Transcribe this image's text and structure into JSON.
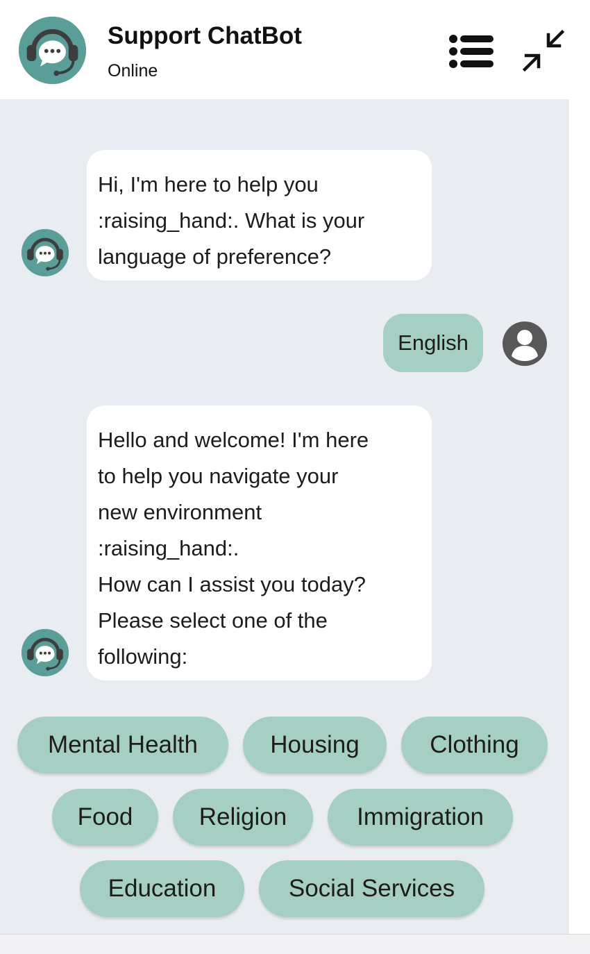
{
  "header": {
    "title": "Support ChatBot",
    "status": "Online",
    "avatar_icon": "headset-chat-icon",
    "menu_icon": "list-icon",
    "minimize_icon": "minimize-arrows-icon"
  },
  "messages": [
    {
      "sender": "bot",
      "lines": [
        "Hi, I'm here to help you",
        ":raising_hand:. What is your",
        "language of preference?"
      ]
    },
    {
      "sender": "user",
      "text": "English"
    },
    {
      "sender": "bot",
      "lines": [
        "Hello and welcome! I'm here",
        "to help you navigate your",
        "new environment",
        ":raising_hand:.",
        "How can I assist you today?",
        "Please select one of the",
        "following:"
      ]
    }
  ],
  "options": [
    "Mental Health",
    "Housing",
    "Clothing",
    "Food",
    "Religion",
    "Immigration",
    "Education",
    "Social Services"
  ],
  "colors": {
    "accent": "#5a9e98",
    "chip": "#a5cfc3",
    "chat_background": "#e9ecf1",
    "bubble": "#ffffff",
    "user_avatar": "#585858"
  }
}
